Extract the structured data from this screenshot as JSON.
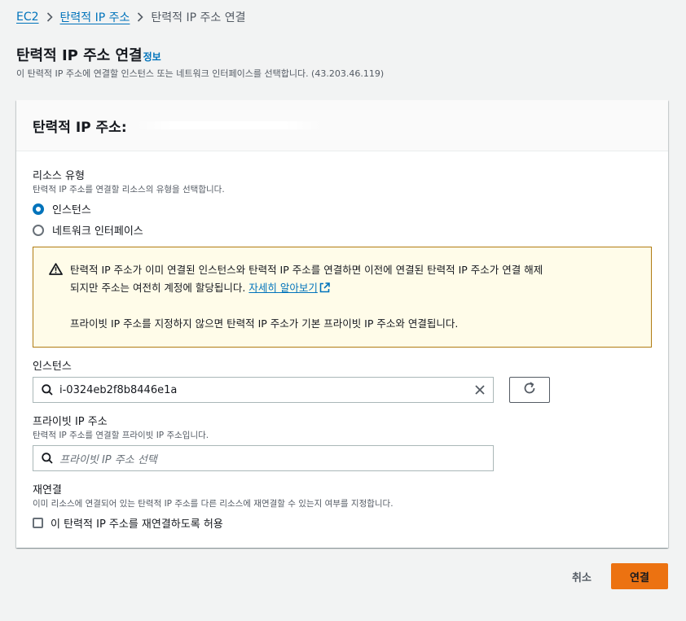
{
  "breadcrumb": {
    "items": [
      {
        "label": "EC2"
      },
      {
        "label": "탄력적 IP 주소"
      },
      {
        "label": "탄력적 IP 주소 연결"
      }
    ]
  },
  "page": {
    "title": "탄력적 IP 주소 연결",
    "info_link": "정보",
    "description": "이 탄력적 IP 주소에 연결할 인스턴스 또는 네트워크 인터페이스를 선택합니다. (43.203.46.119)"
  },
  "panel": {
    "title": "탄력적 IP 주소:"
  },
  "resource_type": {
    "label": "리소스 유형",
    "description": "탄력적 IP 주소를 연결할 리소스의 유형을 선택합니다.",
    "options": [
      {
        "label": "인스턴스",
        "checked": true
      },
      {
        "label": "네트워크 인터페이스",
        "checked": false
      }
    ]
  },
  "alert": {
    "text_line1": "탄력적 IP 주소가 이미 연결된 인스턴스와 탄력적 IP 주소를 연결하면 이전에 연결된 탄력적 IP 주소가 연결 해제",
    "text_line2": "되지만 주소는 여전히 계정에 할당됩니다.",
    "link": "자세히 알아보기",
    "text_para2": "프라이빗 IP 주소를 지정하지 않으면 탄력적 IP 주소가 기본 프라이빗 IP 주소와 연결됩니다.",
    "icon": "warning-icon",
    "border_color": "#b07c12",
    "background": "#fffce9"
  },
  "instance": {
    "label": "인스턴스",
    "value": "i-0324eb2f8b8446e1a"
  },
  "private_ip": {
    "label": "프라이빗 IP 주소",
    "description": "탄력적 IP 주소를 연결할 프라이빗 IP 주소입니다.",
    "placeholder": "프라이빗 IP 주소 선택"
  },
  "reassociation": {
    "label": "재연결",
    "description": "이미 리소스에 연결되어 있는 탄력적 IP 주소를 다른 리소스에 재연결할 수 있는지 여부를 지정합니다.",
    "checkbox_label": "이 탄력적 IP 주소를 재연결하도록 허용",
    "checked": false
  },
  "footer": {
    "cancel": "취소",
    "submit": "연결",
    "submit_color": "#ec7211"
  }
}
